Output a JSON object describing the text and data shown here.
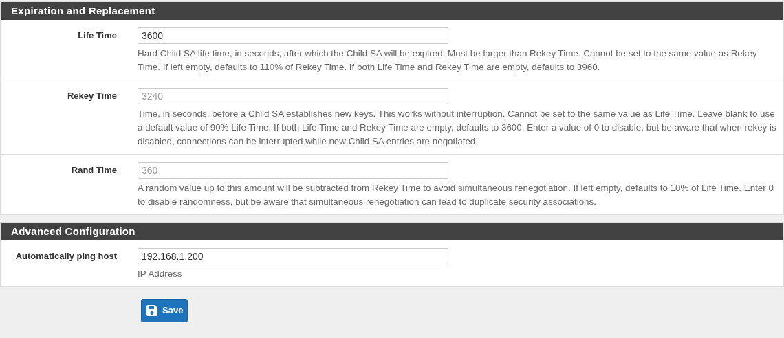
{
  "sections": [
    {
      "title": "Expiration and Replacement",
      "rows": [
        {
          "label": "Life Time",
          "field": {
            "value": "3600"
          },
          "help": "Hard Child SA life time, in seconds, after which the Child SA will be expired. Must be larger than Rekey Time. Cannot be set to the same value as Rekey Time. If left empty, defaults to 110% of Rekey Time. If both Life Time and Rekey Time are empty, defaults to 3960."
        },
        {
          "label": "Rekey Time",
          "field": {
            "placeholder": "3240"
          },
          "help": "Time, in seconds, before a Child SA establishes new keys. This works without interruption. Cannot be set to the same value as Life Time. Leave blank to use a default value of 90% Life Time. If both Life Time and Rekey Time are empty, defaults to 3600. Enter a value of 0 to disable, but be aware that when rekey is disabled, connections can be interrupted while new Child SA entries are negotiated."
        },
        {
          "label": "Rand Time",
          "field": {
            "placeholder": "360"
          },
          "help": "A random value up to this amount will be subtracted from Rekey Time to avoid simultaneous renegotiation. If left empty, defaults to 10% of Life Time. Enter 0 to disable randomness, but be aware that simultaneous renegotiation can lead to duplicate security associations."
        }
      ]
    },
    {
      "title": "Advanced Configuration",
      "rows": [
        {
          "label": "Automatically ping host",
          "field": {
            "value": "192.168.1.200"
          },
          "help": "IP Address"
        }
      ]
    }
  ],
  "save_button": {
    "label": "Save"
  }
}
